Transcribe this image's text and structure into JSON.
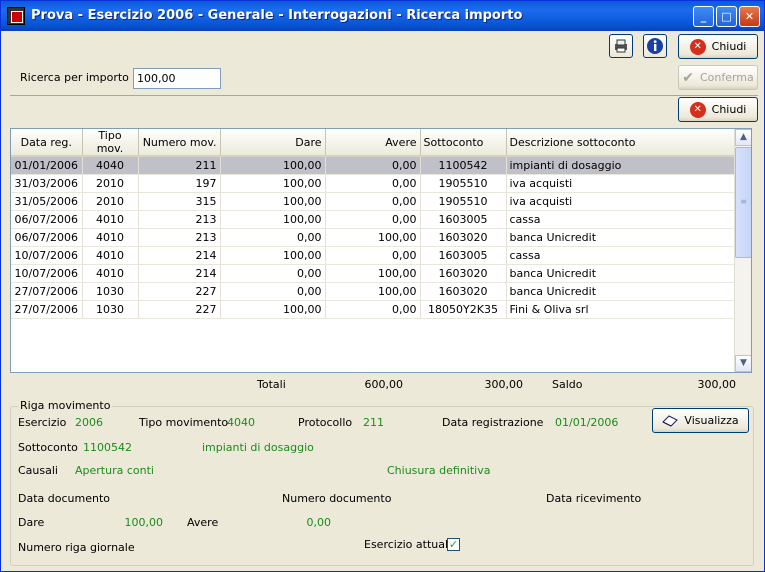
{
  "window": {
    "title": "Prova - Esercizio 2006 - Generale - Interrogazioni - Ricerca importo"
  },
  "title_buttons": {
    "minimize": "_",
    "maximize": "□",
    "close": "✕"
  },
  "toolbar": {
    "close_label": "Chiudi",
    "confirm_label": "Conferma",
    "close2_label": "Chiudi",
    "print_icon": "printer-icon",
    "info_icon": "info-icon"
  },
  "search": {
    "label": "Ricerca per importo",
    "value": "100,00"
  },
  "table": {
    "headers": [
      "Data reg.",
      "Tipo mov.",
      "Numero mov.",
      "Dare",
      "Avere",
      "Sottoconto",
      "Descrizione sottoconto"
    ],
    "rows": [
      [
        "01/01/2006",
        "4040",
        "211",
        "100,00",
        "0,00",
        "1100542",
        "impianti di dosaggio"
      ],
      [
        "31/03/2006",
        "2010",
        "197",
        "100,00",
        "0,00",
        "1905510",
        "iva acquisti"
      ],
      [
        "31/05/2006",
        "2010",
        "315",
        "100,00",
        "0,00",
        "1905510",
        "iva acquisti"
      ],
      [
        "06/07/2006",
        "4010",
        "213",
        "100,00",
        "0,00",
        "1603005",
        "cassa"
      ],
      [
        "06/07/2006",
        "4010",
        "213",
        "0,00",
        "100,00",
        "1603020",
        "banca Unicredit"
      ],
      [
        "10/07/2006",
        "4010",
        "214",
        "100,00",
        "0,00",
        "1603005",
        "cassa"
      ],
      [
        "10/07/2006",
        "4010",
        "214",
        "0,00",
        "100,00",
        "1603020",
        "banca Unicredit"
      ],
      [
        "27/07/2006",
        "1030",
        "227",
        "0,00",
        "100,00",
        "1603020",
        "banca Unicredit"
      ],
      [
        "27/07/2006",
        "1030",
        "227",
        "100,00",
        "0,00",
        "18050Y2K35",
        "Fini & Oliva srl"
      ]
    ]
  },
  "totals": {
    "label": "Totali",
    "dare": "600,00",
    "avere": "300,00",
    "saldo_label": "Saldo",
    "saldo": "300,00"
  },
  "detail": {
    "group_title": "Riga movimento",
    "esercizio_label": "Esercizio",
    "esercizio": "2006",
    "tipo_label": "Tipo movimento",
    "tipo": "4040",
    "protocollo_label": "Protocollo",
    "protocollo": "211",
    "data_reg_label": "Data registrazione",
    "data_reg": "01/01/2006",
    "visualizza_label": "Visualizza",
    "sottoconto_label": "Sottoconto",
    "sottoconto": "1100542",
    "sottoconto_desc": "impianti di dosaggio",
    "causali_label": "Causali",
    "causale1": "Apertura conti",
    "causale2": "Chiusura definitiva",
    "data_doc_label": "Data documento",
    "num_doc_label": "Numero documento",
    "data_ric_label": "Data ricevimento",
    "dare_label": "Dare",
    "dare": "100,00",
    "avere_label": "Avere",
    "avere": "0,00",
    "num_riga_label": "Numero riga giornale",
    "esercizio_attuale_label": "Esercizio attuale",
    "esercizio_attuale_checked": "✓"
  }
}
